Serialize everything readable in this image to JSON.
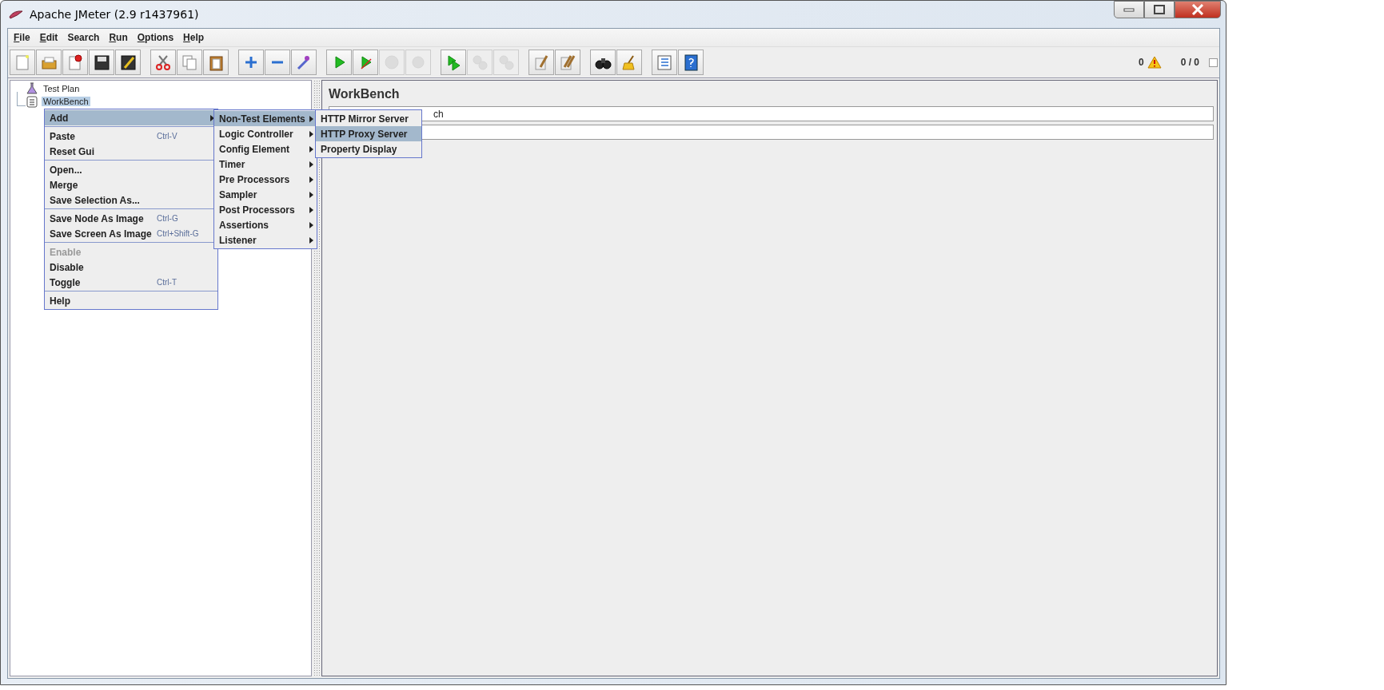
{
  "window": {
    "title": "Apache JMeter (2.9 r1437961)"
  },
  "menu_bar": [
    {
      "label": "File",
      "underlined": true
    },
    {
      "label": "Edit",
      "underlined": true
    },
    {
      "label": "Search",
      "underlined": false
    },
    {
      "label": "Run",
      "underlined": true
    },
    {
      "label": "Options",
      "underlined": true
    },
    {
      "label": "Help",
      "underlined": true
    }
  ],
  "toolbar": [
    [
      {
        "disabled": false
      },
      {
        "disabled": false
      },
      {
        "disabled": false
      },
      {
        "disabled": false
      },
      {
        "disabled": false
      }
    ],
    [
      {
        "disabled": false
      },
      {
        "disabled": false
      },
      {
        "disabled": false
      }
    ],
    [
      {
        "disabled": false
      },
      {
        "disabled": false
      },
      {
        "disabled": false
      }
    ],
    [
      {
        "disabled": false
      },
      {
        "disabled": false
      },
      {
        "disabled": true
      },
      {
        "disabled": true
      }
    ],
    [
      {
        "disabled": false
      },
      {
        "disabled": true
      },
      {
        "disabled": true
      }
    ],
    [
      {
        "disabled": false
      },
      {
        "disabled": false
      }
    ],
    [
      {
        "disabled": false
      },
      {
        "disabled": false
      }
    ],
    [
      {
        "disabled": false
      },
      {
        "disabled": false
      }
    ]
  ],
  "status": {
    "error_count": "0",
    "threads": "0 / 0"
  },
  "tree": [
    {
      "label": "Test Plan",
      "kind": "plan",
      "selected": false
    },
    {
      "label": "WorkBench",
      "kind": "workbench",
      "selected": true
    }
  ],
  "panel": {
    "title": "WorkBench",
    "name_field_value": "ch"
  },
  "context_menu": [
    {
      "kind": "item",
      "label": "Add",
      "selected": true,
      "submenu": true,
      "disabled": false
    },
    {
      "kind": "separator"
    },
    {
      "kind": "item",
      "label": "Paste",
      "shortcut": "Ctrl-V",
      "selected": false,
      "submenu": false,
      "disabled": false
    },
    {
      "kind": "item",
      "label": "Reset Gui",
      "selected": false,
      "submenu": false,
      "disabled": false
    },
    {
      "kind": "separator"
    },
    {
      "kind": "item",
      "label": "Open...",
      "selected": false,
      "submenu": false,
      "disabled": false
    },
    {
      "kind": "item",
      "label": "Merge",
      "selected": false,
      "submenu": false,
      "disabled": false
    },
    {
      "kind": "item",
      "label": "Save Selection As...",
      "selected": false,
      "submenu": false,
      "disabled": false
    },
    {
      "kind": "separator"
    },
    {
      "kind": "item",
      "label": "Save Node As Image",
      "shortcut": "Ctrl-G",
      "selected": false,
      "submenu": false,
      "disabled": false
    },
    {
      "kind": "item",
      "label": "Save Screen As Image",
      "shortcut": "Ctrl+Shift-G",
      "selected": false,
      "submenu": false,
      "disabled": false
    },
    {
      "kind": "separator"
    },
    {
      "kind": "item",
      "label": "Enable",
      "selected": false,
      "submenu": false,
      "disabled": true
    },
    {
      "kind": "item",
      "label": "Disable",
      "selected": false,
      "submenu": false,
      "disabled": false
    },
    {
      "kind": "item",
      "label": "Toggle",
      "shortcut": "Ctrl-T",
      "selected": false,
      "submenu": false,
      "disabled": false
    },
    {
      "kind": "separator"
    },
    {
      "kind": "item",
      "label": "Help",
      "selected": false,
      "submenu": false,
      "disabled": false
    }
  ],
  "add_submenu": [
    {
      "kind": "item",
      "label": "Non-Test Elements",
      "selected": true,
      "submenu": true,
      "disabled": false
    },
    {
      "kind": "item",
      "label": "Logic Controller",
      "selected": false,
      "submenu": true,
      "disabled": false
    },
    {
      "kind": "item",
      "label": "Config Element",
      "selected": false,
      "submenu": true,
      "disabled": false
    },
    {
      "kind": "item",
      "label": "Timer",
      "selected": false,
      "submenu": true,
      "disabled": false
    },
    {
      "kind": "item",
      "label": "Pre Processors",
      "selected": false,
      "submenu": true,
      "disabled": false
    },
    {
      "kind": "item",
      "label": "Sampler",
      "selected": false,
      "submenu": true,
      "disabled": false
    },
    {
      "kind": "item",
      "label": "Post Processors",
      "selected": false,
      "submenu": true,
      "disabled": false
    },
    {
      "kind": "item",
      "label": "Assertions",
      "selected": false,
      "submenu": true,
      "disabled": false
    },
    {
      "kind": "item",
      "label": "Listener",
      "selected": false,
      "submenu": true,
      "disabled": false
    }
  ],
  "non_test_submenu": [
    {
      "kind": "item",
      "label": "HTTP Mirror Server",
      "selected": false,
      "submenu": false,
      "disabled": false
    },
    {
      "kind": "item",
      "label": "HTTP Proxy Server",
      "selected": true,
      "submenu": false,
      "disabled": false
    },
    {
      "kind": "item",
      "label": "Property Display",
      "selected": false,
      "submenu": false,
      "disabled": false
    }
  ]
}
